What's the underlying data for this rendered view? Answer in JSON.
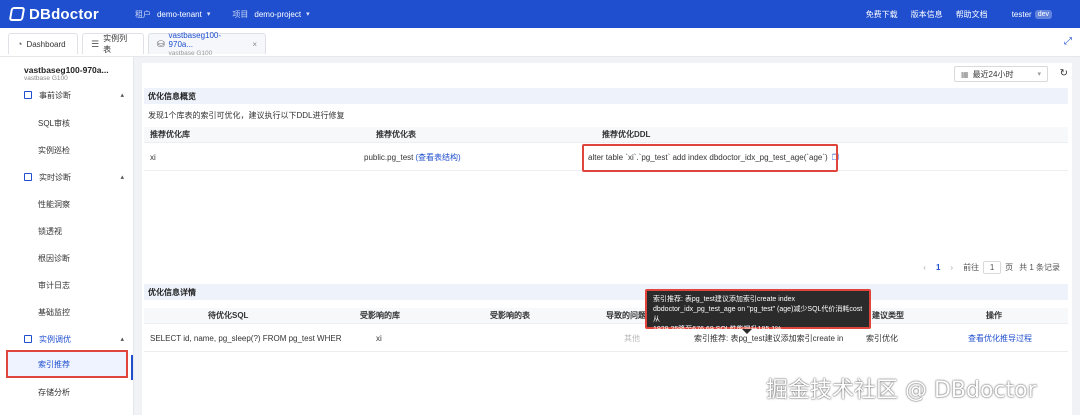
{
  "app": {
    "name": "DBdoctor"
  },
  "header": {
    "tenant_label": "租户",
    "tenant_value": "demo-tenant",
    "project_label": "项目",
    "project_value": "demo-project",
    "links": [
      "免费下载",
      "版本信息",
      "帮助文档"
    ],
    "user": "tester",
    "user_badge": "dev"
  },
  "tabs": [
    {
      "label": "Dashboard"
    },
    {
      "label": "实例列表"
    },
    {
      "label": "vastbaseg100-970a...",
      "sub": "vastbase G100",
      "close": "×"
    }
  ],
  "sidebar": {
    "instance_name": "vastbaseg100-970a...",
    "instance_type": "vastbase G100",
    "groups": [
      {
        "label": "事前诊断",
        "items": [
          "SQL审核",
          "实例巡检"
        ]
      },
      {
        "label": "实时诊断",
        "items": [
          "性能洞察",
          "锁透视",
          "根因诊断",
          "审计日志",
          "基础监控"
        ]
      },
      {
        "label": "实例调优",
        "items": [
          "索引推荐",
          "存储分析"
        ]
      }
    ]
  },
  "toolbar": {
    "range": "最近24小时"
  },
  "overview": {
    "title": "优化信息概览",
    "description": "发现1个库表的索引可优化，建议执行以下DDL进行修复",
    "columns": [
      "推荐优化库",
      "推荐优化表",
      "推荐优化DDL"
    ],
    "row": {
      "db": "xi",
      "table": "public.pg_test",
      "table_link": "(查看表结构)",
      "ddl": "alter table `xi`.`pg_test` add index dbdoctor_idx_pg_test_age(`age`)"
    }
  },
  "pagination": {
    "prev": "‹",
    "page": "1",
    "next": "›",
    "goto_label": "前往",
    "goto_value": "1",
    "page_unit": "页",
    "total": "共 1 条记录"
  },
  "details": {
    "title": "优化信息详情",
    "columns": [
      "待优化SQL",
      "受影响的库",
      "受影响的表",
      "导致的问题",
      "",
      "建议类型",
      "操作"
    ],
    "row": {
      "sql": "SELECT id, name, pg_sleep(?) FROM pg_test WHER",
      "db": "xi",
      "problem": "其他",
      "suggestion": "索引推荐: 表pg_test建议添加索引create in",
      "type": "索引优化",
      "action": "查看优化推导过程"
    }
  },
  "tooltip": {
    "line1": "索引推荐: 表pg_test建议添加索引create index",
    "line2": "dbdoctor_idx_pg_test_age on \"pg_test\" (age)减少SQL代价消耗cost从",
    "line3": "1929.25降至676.69,SQL性能提升185.1%"
  },
  "watermark": "掘金技术社区 @ DBdoctor"
}
